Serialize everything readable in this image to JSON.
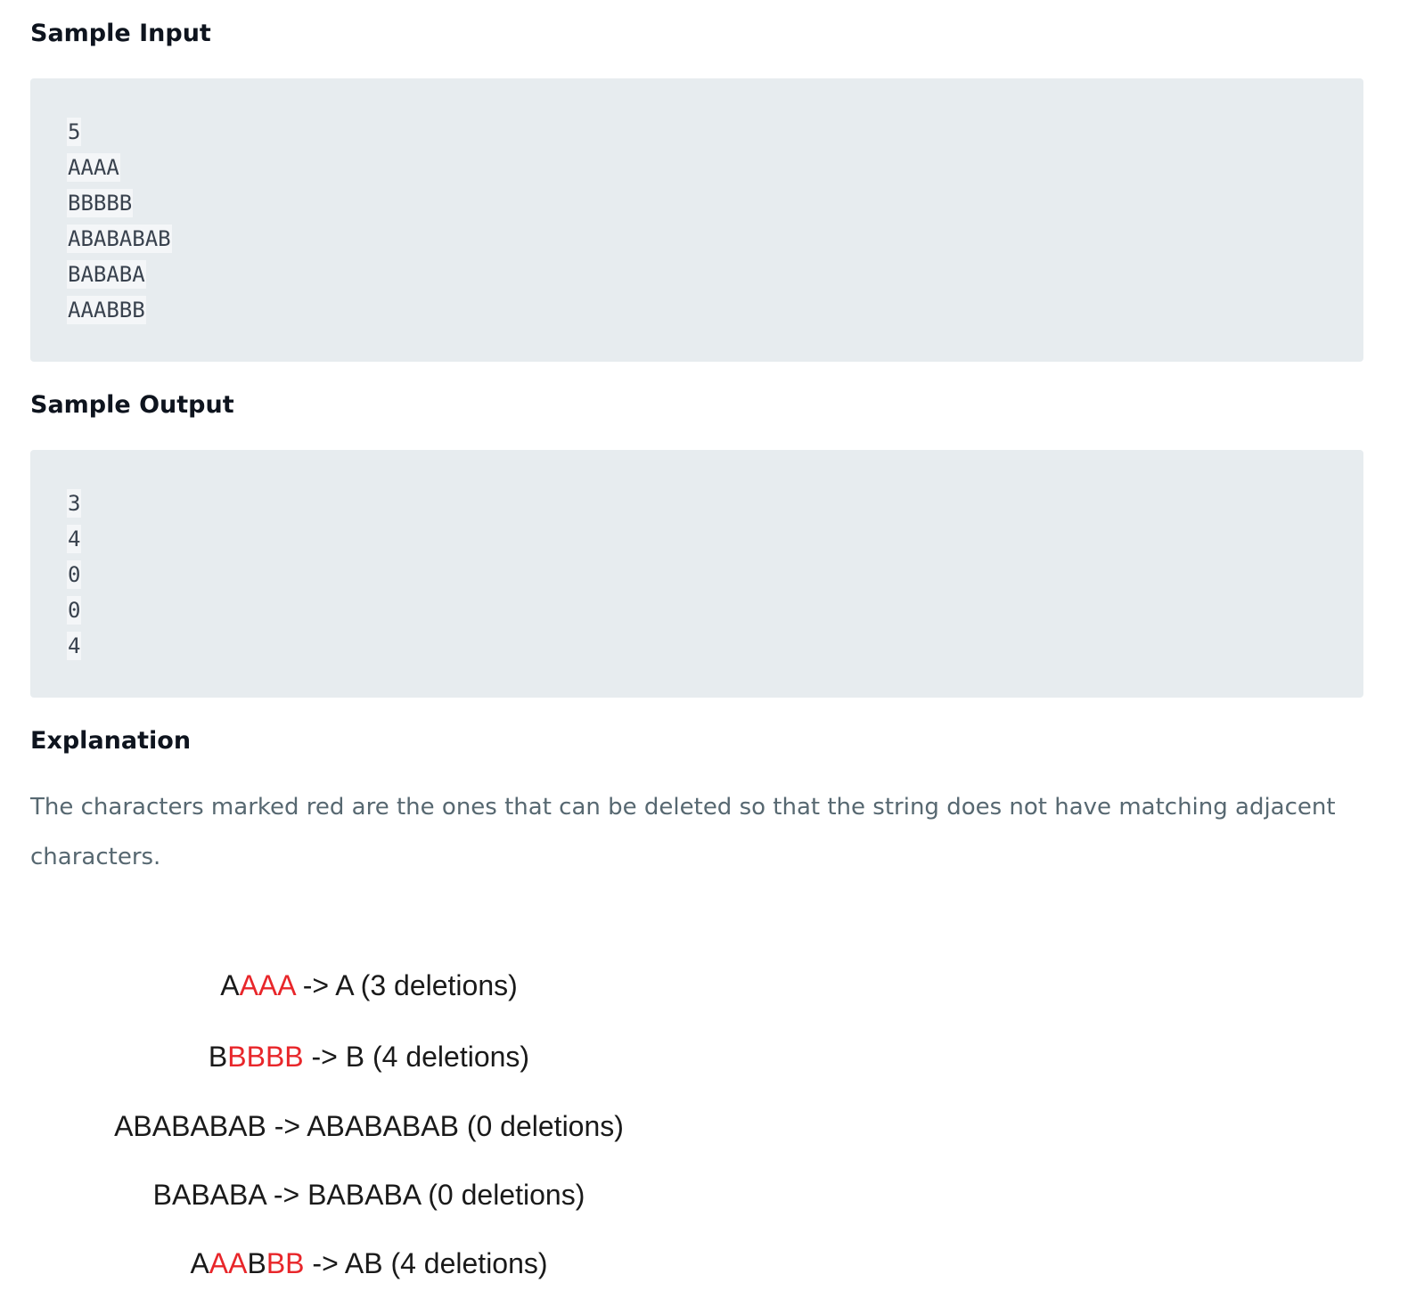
{
  "sample_input": {
    "heading": "Sample Input",
    "lines": [
      "5",
      "AAAA",
      "BBBBB",
      "ABABABAB",
      "BABABA",
      "AAABBB"
    ]
  },
  "sample_output": {
    "heading": "Sample Output",
    "lines": [
      "3",
      "4",
      "0",
      "0",
      "4"
    ]
  },
  "explanation": {
    "heading": "Explanation",
    "text": "The characters marked red are the ones that can be deleted so that the string does not have matching adjacent characters.",
    "figure_lines": [
      {
        "keep": "A",
        "delete": "AAA",
        "rest": " -> A (3 deletions)"
      },
      {
        "keep": "B",
        "delete": "BBBB",
        "rest": " -> B (4 deletions)"
      },
      {
        "keep": "ABABABAB",
        "delete": "",
        "rest": " -> ABABABAB (0 deletions)"
      },
      {
        "keep": "BABABA",
        "delete": "",
        "rest": " -> BABABA (0 deletions)"
      },
      {
        "parts": [
          {
            "text": "A",
            "red": false
          },
          {
            "text": "AA",
            "red": true
          },
          {
            "text": "B",
            "red": false
          },
          {
            "text": "BB",
            "red": true
          },
          {
            "text": " -> AB (4 deletions)",
            "red": false
          }
        ]
      }
    ]
  },
  "colors": {
    "code_background": "#e7ecef",
    "deleted_char": "#e8262a",
    "body_text": "#576871",
    "heading_text": "#0e141e"
  }
}
